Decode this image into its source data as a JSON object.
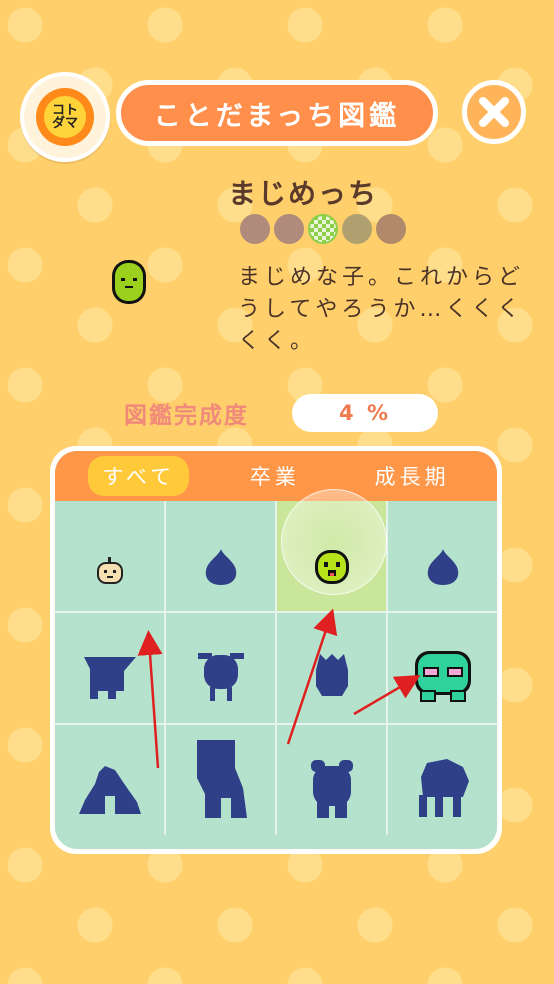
{
  "header": {
    "logo_text": "コト\nダマ",
    "title": "ことだまっち図鑑"
  },
  "character": {
    "name": "まじめっち",
    "description": "まじめな子。これからどうしてやろうか…くくくくく。",
    "status_icons": [
      {
        "name": "heart-icon",
        "color": "#b08a7a"
      },
      {
        "name": "cat-face-icon",
        "color": "#b08a7a"
      },
      {
        "name": "checker-icon",
        "color": "#8ccf4a"
      },
      {
        "name": "sun-icon",
        "color": "#b0a070"
      },
      {
        "name": "moon-icon",
        "color": "#b08a6a"
      }
    ]
  },
  "completion": {
    "label": "図鑑完成度",
    "value": "4 %"
  },
  "tabs": [
    {
      "label": "すべて",
      "active": true
    },
    {
      "label": "卒業",
      "active": false
    },
    {
      "label": "成長期",
      "active": false
    }
  ],
  "grid": [
    {
      "name": "baby-character-icon",
      "state": "unlocked"
    },
    {
      "name": "blob-silhouette-icon",
      "state": "locked"
    },
    {
      "name": "majimetchi-icon",
      "state": "selected"
    },
    {
      "name": "blob-silhouette-icon",
      "state": "locked"
    },
    {
      "name": "beak-silhouette-icon",
      "state": "locked"
    },
    {
      "name": "round-silhouette-icon",
      "state": "locked"
    },
    {
      "name": "oval-silhouette-icon",
      "state": "locked"
    },
    {
      "name": "frog-character-icon",
      "state": "unlocked"
    },
    {
      "name": "crouch-silhouette-icon",
      "state": "locked"
    },
    {
      "name": "tall-silhouette-icon",
      "state": "locked"
    },
    {
      "name": "bear-silhouette-icon",
      "state": "locked"
    },
    {
      "name": "walker-silhouette-icon",
      "state": "locked"
    }
  ],
  "colors": {
    "background": "#ffcf6b",
    "accent": "#ff8f4a",
    "silhouette": "#2f3f88",
    "annotation_arrow": "#e02020"
  }
}
